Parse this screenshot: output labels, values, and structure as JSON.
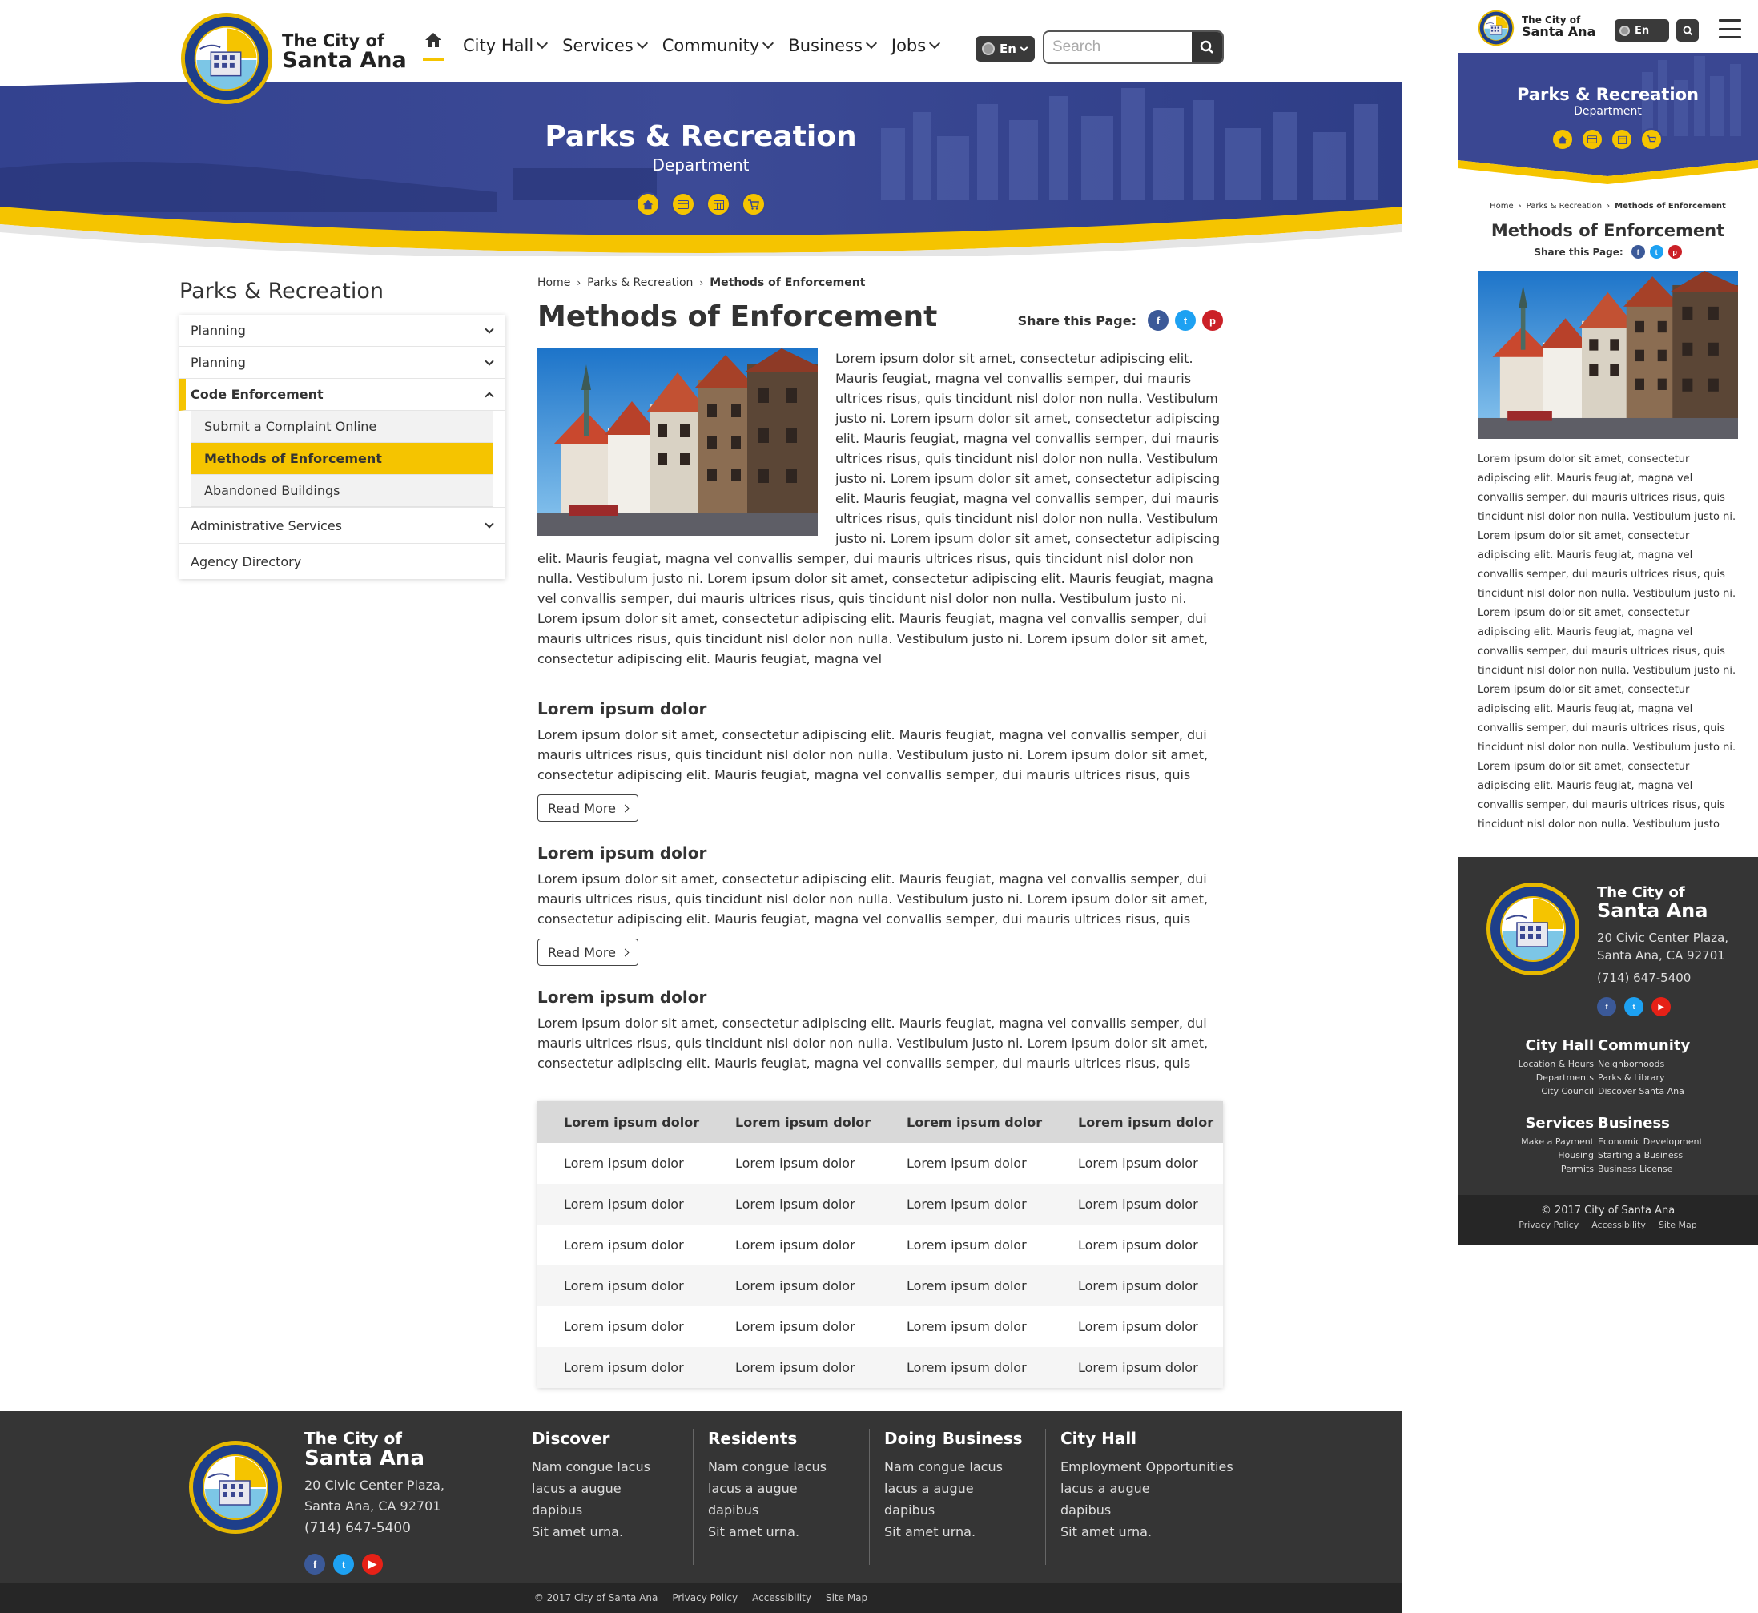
{
  "brand": {
    "line1": "The City of",
    "line2": "Santa Ana"
  },
  "nav": {
    "items": [
      {
        "label": "City Hall"
      },
      {
        "label": "Services"
      },
      {
        "label": "Community"
      },
      {
        "label": "Business"
      },
      {
        "label": "Jobs"
      }
    ],
    "lang": "En",
    "search_placeholder": "Search"
  },
  "banner": {
    "title": "Parks & Recreation",
    "subtitle": "Department"
  },
  "sidebar": {
    "title": "Parks & Recreation",
    "items": [
      {
        "label": "Planning"
      },
      {
        "label": "Planning"
      },
      {
        "label": "Code Enforcement"
      },
      {
        "label": "Administrative Services"
      },
      {
        "label": "Agency Directory"
      }
    ],
    "subitems": [
      {
        "label": "Submit a Complaint Online"
      },
      {
        "label": "Methods of Enforcement"
      },
      {
        "label": "Abandoned Buildings"
      }
    ]
  },
  "breadcrumb": {
    "home": "Home",
    "section": "Parks & Recreation",
    "current": "Methods of Enforcement"
  },
  "page": {
    "title": "Methods of Enforcement",
    "share_label": "Share this Page:",
    "intro": "Lorem ipsum dolor sit amet, consectetur adipiscing elit. Mauris feugiat, magna vel convallis semper, dui mauris ultrices risus, quis tincidunt nisl dolor non nulla. Vestibulum justo ni. Lorem ipsum dolor sit amet, consectetur adipiscing elit. Mauris feugiat, magna vel convallis semper, dui mauris ultrices risus, quis tincidunt nisl dolor non nulla. Vestibulum justo ni. Lorem ipsum dolor sit amet, consectetur adipiscing elit. Mauris feugiat, magna vel convallis semper, dui mauris ultrices risus, quis tincidunt nisl dolor non nulla. Vestibulum justo ni. Lorem ipsum dolor sit amet, consectetur adipiscing elit. Mauris feugiat, magna vel convallis semper, dui mauris ultrices risus, quis tincidunt nisl dolor non nulla. Vestibulum justo ni. Lorem ipsum dolor sit amet, consectetur adipiscing elit. Mauris feugiat, magna vel convallis semper, dui mauris ultrices risus, quis tincidunt nisl dolor non nulla. Vestibulum justo ni. Lorem ipsum dolor sit amet, consectetur adipiscing elit. Mauris feugiat, magna vel convallis semper, dui mauris ultrices risus, quis tincidunt nisl dolor non nulla. Vestibulum justo ni. Lorem ipsum dolor sit amet, consectetur adipiscing elit. Mauris feugiat, magna vel",
    "sections": [
      {
        "heading": "Lorem ipsum dolor",
        "text": "Lorem ipsum dolor sit amet, consectetur adipiscing elit. Mauris feugiat, magna vel convallis semper, dui mauris ultrices risus, quis tincidunt nisl dolor non nulla. Vestibulum justo ni. Lorem ipsum dolor sit amet, consectetur adipiscing elit. Mauris feugiat, magna vel convallis semper, dui mauris ultrices risus, quis",
        "button": "Read More"
      },
      {
        "heading": "Lorem ipsum dolor",
        "text": "Lorem ipsum dolor sit amet, consectetur adipiscing elit. Mauris feugiat, magna vel convallis semper, dui mauris ultrices risus, quis tincidunt nisl dolor non nulla. Vestibulum justo ni. Lorem ipsum dolor sit amet, consectetur adipiscing elit. Mauris feugiat, magna vel convallis semper, dui mauris ultrices risus, quis",
        "button": "Read More"
      },
      {
        "heading": "Lorem ipsum dolor",
        "text": "Lorem ipsum dolor sit amet, consectetur adipiscing elit. Mauris feugiat, magna vel convallis semper, dui mauris ultrices risus, quis tincidunt nisl dolor non nulla. Vestibulum justo ni. Lorem ipsum dolor sit amet, consectetur adipiscing elit. Mauris feugiat, magna vel convallis semper, dui mauris ultrices risus, quis"
      }
    ]
  },
  "table": {
    "headers": [
      "Lorem ipsum dolor",
      "Lorem ipsum dolor",
      "Lorem ipsum dolor",
      "Lorem ipsum dolor"
    ],
    "rows": [
      [
        "Lorem ipsum dolor",
        "Lorem ipsum dolor",
        "Lorem ipsum dolor",
        "Lorem ipsum dolor"
      ],
      [
        "Lorem ipsum dolor",
        "Lorem ipsum dolor",
        "Lorem ipsum dolor",
        "Lorem ipsum dolor"
      ],
      [
        "Lorem ipsum dolor",
        "Lorem ipsum dolor",
        "Lorem ipsum dolor",
        "Lorem ipsum dolor"
      ],
      [
        "Lorem ipsum dolor",
        "Lorem ipsum dolor",
        "Lorem ipsum dolor",
        "Lorem ipsum dolor"
      ],
      [
        "Lorem ipsum dolor",
        "Lorem ipsum dolor",
        "Lorem ipsum dolor",
        "Lorem ipsum dolor"
      ],
      [
        "Lorem ipsum dolor",
        "Lorem ipsum dolor",
        "Lorem ipsum dolor",
        "Lorem ipsum dolor"
      ]
    ]
  },
  "footer": {
    "address1": "20 Civic Center Plaza,",
    "address2": "Santa Ana, CA 92701",
    "phone": "(714) 647-5400",
    "columns": [
      {
        "title": "Discover",
        "links": [
          "Nam congue lacus",
          "lacus a augue",
          "dapibus",
          "Sit amet urna."
        ]
      },
      {
        "title": "Residents",
        "links": [
          "Nam congue lacus",
          "lacus a augue",
          "dapibus",
          "Sit amet urna."
        ]
      },
      {
        "title": "Doing Business",
        "links": [
          "Nam congue lacus",
          "lacus a augue",
          "dapibus",
          "Sit amet urna."
        ]
      },
      {
        "title": "City Hall",
        "links": [
          "Employment Opportunities",
          "lacus a augue",
          "dapibus",
          "Sit amet urna."
        ]
      }
    ],
    "copyright": "© 2017 City of Santa Ana",
    "bottom_links": [
      "Privacy Policy",
      "Accessibility",
      "Site Map"
    ]
  },
  "mobile": {
    "text": "Lorem ipsum dolor sit amet, consectetur adipiscing elit. Mauris feugiat, magna vel convallis semper, dui mauris ultrices risus, quis tincidunt nisl dolor non nulla. Vestibulum justo ni. Lorem ipsum dolor sit amet, consectetur adipiscing elit. Mauris feugiat, magna vel convallis semper, dui mauris ultrices risus, quis tincidunt nisl dolor non nulla. Vestibulum justo ni. Lorem ipsum dolor sit amet, consectetur adipiscing elit. Mauris feugiat, magna vel convallis semper, dui mauris ultrices risus, quis tincidunt nisl dolor non nulla. Vestibulum justo ni. Lorem ipsum dolor sit amet, consectetur adipiscing elit. Mauris feugiat, magna vel convallis semper, dui mauris ultrices risus, quis tincidunt nisl dolor non nulla. Vestibulum justo ni. Lorem ipsum dolor sit amet, consectetur adipiscing elit. Mauris feugiat, magna vel convallis semper, dui mauris ultrices risus, quis tincidunt nisl dolor non nulla. Vestibulum justo",
    "footer_columns": [
      {
        "title": "City Hall",
        "links": [
          "Location & Hours",
          "Departments",
          "City Council"
        ]
      },
      {
        "title": "Community",
        "links": [
          "Neighborhoods",
          "Parks & Library",
          "Discover Santa Ana"
        ]
      },
      {
        "title": "Services",
        "links": [
          "Make a Payment",
          "Housing",
          "Permits"
        ]
      },
      {
        "title": "Business",
        "links": [
          "Economic Development",
          "Starting a Business",
          "Business License"
        ]
      }
    ]
  },
  "colors": {
    "accent": "#f5c400",
    "banner_blue": "#3a4792",
    "footer_dark": "#353535"
  }
}
